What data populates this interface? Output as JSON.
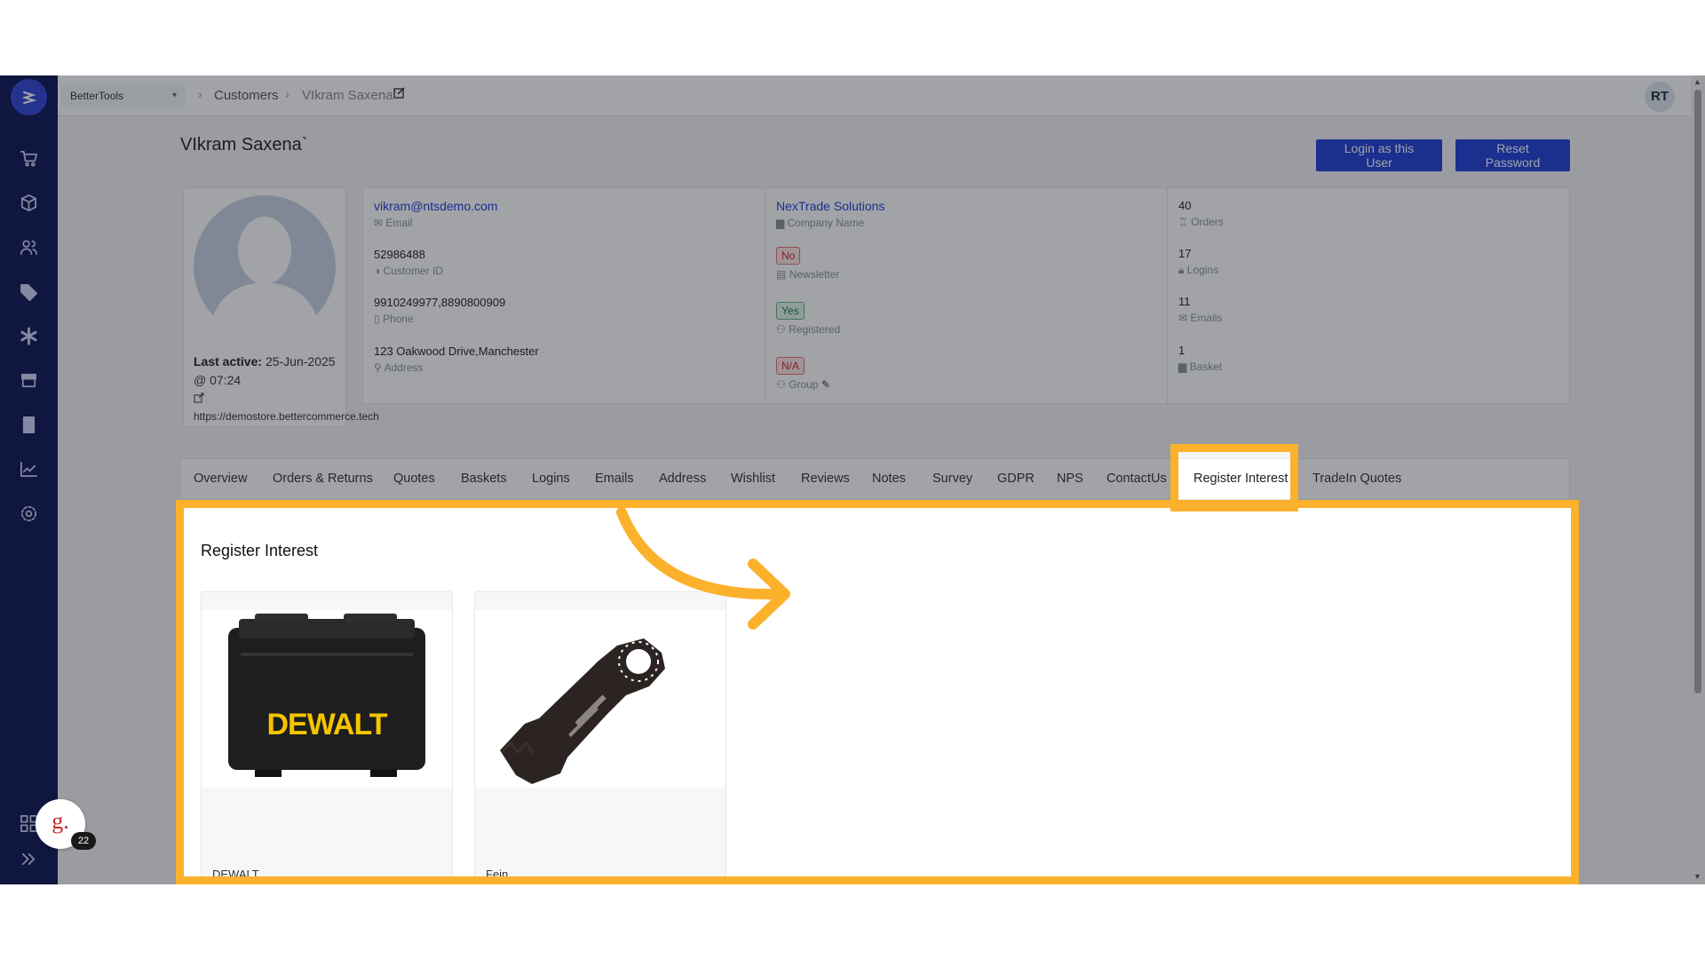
{
  "app": {
    "store_selector": "BetterTools",
    "breadcrumb": [
      "Customers",
      "VIkram Saxena`"
    ],
    "user_initials": "RT"
  },
  "customer": {
    "name": "VIkram Saxena`",
    "last_active_label": "Last active:",
    "last_active_value": "25-Jun-2025",
    "last_active_time": "@ 07:24",
    "site_url": "https://demostore.bettercommerce.tech"
  },
  "actions": {
    "login_as_user": "Login as this User",
    "reset_password": "Reset Password"
  },
  "info": {
    "col1": [
      {
        "value": "vikram@ntsdemo.com",
        "label": "Email",
        "icon": "mail-icon"
      },
      {
        "value": "52986488",
        "label": "Customer ID",
        "icon": "id-icon"
      },
      {
        "value": "9910249977,8890800909",
        "label": "Phone",
        "icon": "phone-icon"
      },
      {
        "value": "123 Oakwood Drive,Manchester",
        "label": "Address",
        "icon": "pin-icon"
      }
    ],
    "col2": {
      "company": {
        "value": "NexTrade Solutions",
        "label": "Company Name"
      },
      "newsletter": {
        "value": "No",
        "label": "Newsletter"
      },
      "registered": {
        "value": "Yes",
        "label": "Registered"
      },
      "group": {
        "value": "N/A",
        "label": "Group"
      }
    },
    "col3": [
      {
        "value": "40",
        "label": "Orders"
      },
      {
        "value": "17",
        "label": "Logins"
      },
      {
        "value": "11",
        "label": "Emails"
      },
      {
        "value": "1",
        "label": "Basket"
      }
    ]
  },
  "tabs": [
    "Overview",
    "Orders & Returns",
    "Quotes",
    "Baskets",
    "Logins",
    "Emails",
    "Address",
    "Wishlist",
    "Reviews",
    "Notes",
    "Survey",
    "GDPR",
    "NPS",
    "ContactUs",
    "Register Interest",
    "TradeIn Quotes"
  ],
  "active_tab": "Register Interest",
  "section": {
    "title": "Register Interest",
    "products": [
      {
        "name": "DEWALT",
        "image": "dewalt-case"
      },
      {
        "name": "Fein",
        "image": "saw-blade"
      }
    ]
  },
  "widget": {
    "letter": "g.",
    "count": "22"
  },
  "colors": {
    "highlight": "#fbb12b",
    "primary": "#1f3fd6",
    "sidebar": "#0c1452"
  }
}
